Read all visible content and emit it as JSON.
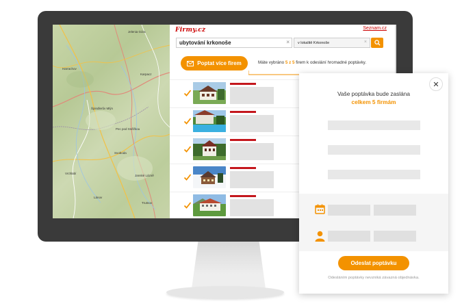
{
  "site": {
    "logo": "Firmy.cz",
    "seznam_link": "Seznam.cz",
    "search_value": "ubytování krkonoše",
    "location_value": "v lokalitě Krkonoše",
    "poptat_label": "Poptat více firem",
    "selected_prefix": "Máte vybráno ",
    "selected_count": "5 z 5",
    "selected_suffix": " firem k odeslání hromadné poptávky."
  },
  "map": {
    "labels": [
      "Harrachov",
      "Špindlerův Mlýn",
      "Pec pod Sněžkou",
      "Vrchlabí",
      "Janské Lázně",
      "Karpacz",
      "Jelenia Góra",
      "Trutnov",
      "Lánov",
      "Svoboda"
    ]
  },
  "results": [
    {
      "checked": true,
      "scene": "chalet-green"
    },
    {
      "checked": true,
      "scene": "pool-hotel"
    },
    {
      "checked": true,
      "scene": "chalet-forest"
    },
    {
      "checked": true,
      "scene": "winter-chalet"
    },
    {
      "checked": true,
      "scene": "mountain-hotel"
    }
  ],
  "modal": {
    "title": "Vaše poptávka bude zaslána",
    "subtitle": "celkem 5 firmám",
    "send_label": "Odeslat poptávku",
    "note": "Odesláním poptávky nevzniká závazná objednávka."
  },
  "colors": {
    "accent": "#f39200",
    "brand_red": "#c4161c",
    "monitor": "#3a3a3a"
  },
  "icons": [
    "close-icon",
    "calendar-icon",
    "user-icon",
    "search-icon",
    "envelope-icon",
    "checkmark-icon",
    "clear-icon"
  ]
}
